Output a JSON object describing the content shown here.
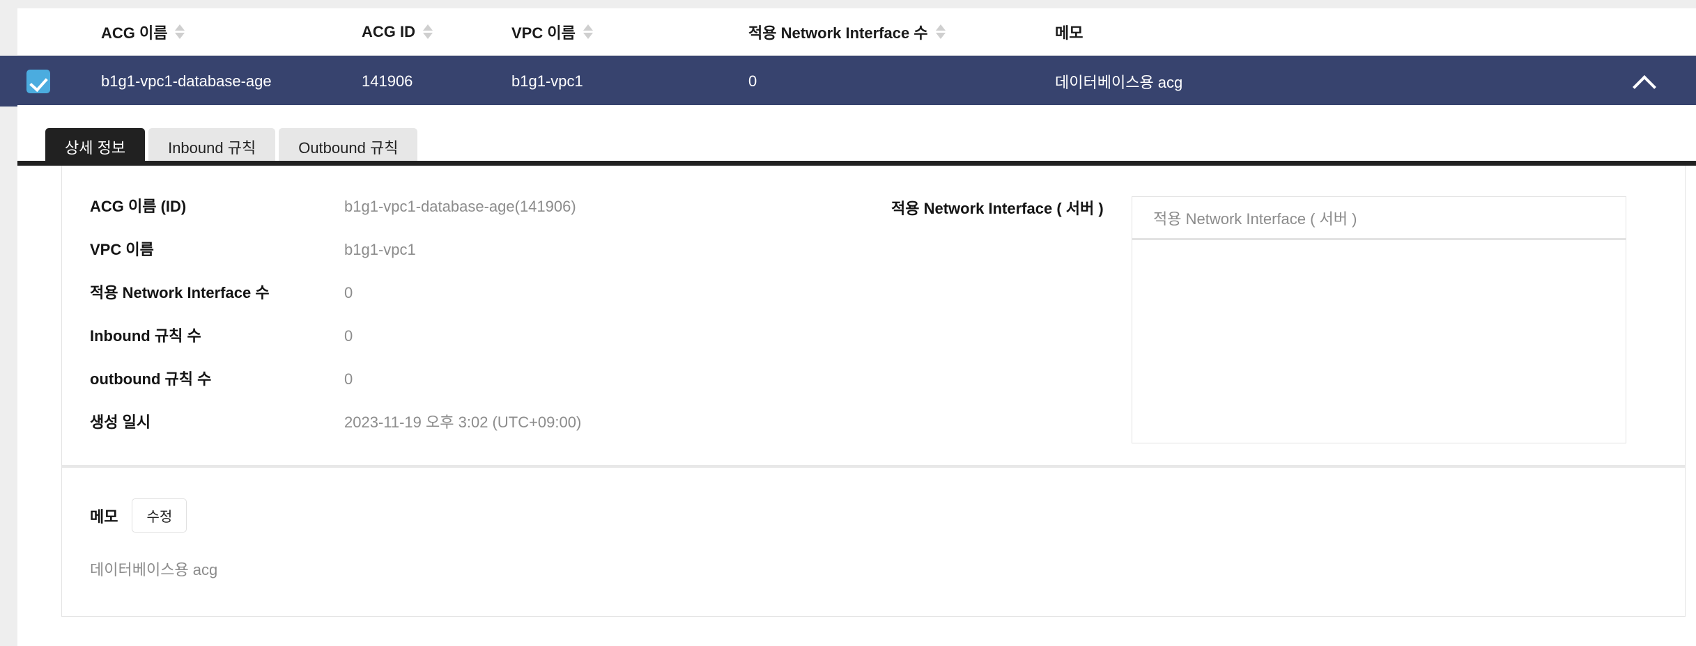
{
  "table": {
    "columns": [
      {
        "key": "checkbox",
        "label": "",
        "sortable": false
      },
      {
        "key": "acg_name",
        "label": "ACG 이름",
        "sortable": true
      },
      {
        "key": "acg_id",
        "label": "ACG ID",
        "sortable": true
      },
      {
        "key": "vpc_name",
        "label": "VPC 이름",
        "sortable": true
      },
      {
        "key": "nic_count",
        "label": "적용 Network Interface 수",
        "sortable": true
      },
      {
        "key": "memo",
        "label": "메모",
        "sortable": false
      }
    ],
    "selected_row": {
      "checked": true,
      "acg_name": "b1g1-vpc1-database-age",
      "acg_id": "141906",
      "vpc_name": "b1g1-vpc1",
      "nic_count": "0",
      "memo": "데이터베이스용 acg",
      "expand_state": "expanded"
    },
    "colors": {
      "selected_row_bg": "#37436e",
      "checkbox_bg": "#4bacdf",
      "header_text": "#1a1a1a"
    }
  },
  "detail": {
    "tabs": [
      {
        "label": "상세 정보",
        "active": true
      },
      {
        "label": "Inbound 규칙",
        "active": false
      },
      {
        "label": "Outbound 규칙",
        "active": false
      }
    ],
    "fields": [
      {
        "label": "ACG 이름 (ID)",
        "value": "b1g1-vpc1-database-age(141906)"
      },
      {
        "label": "VPC 이름",
        "value": "b1g1-vpc1"
      },
      {
        "label": "적용 Network Interface 수",
        "value": "0"
      },
      {
        "label": "Inbound 규칙 수",
        "value": "0"
      },
      {
        "label": "outbound 규칙 수",
        "value": "0"
      },
      {
        "label": "생성 일시",
        "value": "2023-11-19 오후 3:02 (UTC+09:00)"
      }
    ],
    "nic_panel": {
      "label": "적용 Network Interface ( 서버 )",
      "box_header": "적용 Network Interface ( 서버 )",
      "rows": []
    },
    "memo": {
      "title": "메모",
      "edit_label": "수정",
      "text": "데이터베이스용 acg"
    }
  }
}
